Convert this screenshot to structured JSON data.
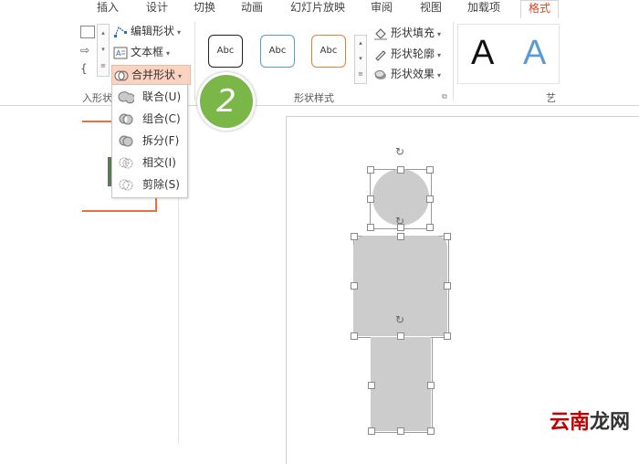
{
  "tabs": [
    "插入",
    "设计",
    "切换",
    "动画",
    "幻灯片放映",
    "审阅",
    "视图",
    "加载项",
    "格式"
  ],
  "ribbon": {
    "insert_shapes": {
      "edit_shape": "编辑形状",
      "text_box": "文本框",
      "merge_shapes": "合并形状",
      "group_label_partial": "入形状"
    },
    "shape_styles": {
      "samples": [
        "Abc",
        "Abc",
        "Abc"
      ],
      "sample_colors": [
        "#222222",
        "#5b9bd5",
        "#ed7d31"
      ],
      "fill": "形状填充",
      "outline": "形状轮廓",
      "effects": "形状效果",
      "group_label": "形状样式"
    },
    "wordart": {
      "samples": [
        "A",
        "A"
      ],
      "sample_colors": [
        "#111111",
        "#5b9bd5"
      ],
      "group_label_partial": "艺"
    }
  },
  "merge_menu": {
    "items": [
      {
        "label": "联合(U)",
        "icon": "union-icon"
      },
      {
        "label": "组合(C)",
        "icon": "combine-icon"
      },
      {
        "label": "拆分(F)",
        "icon": "fragment-icon"
      },
      {
        "label": "相交(I)",
        "icon": "intersect-icon"
      },
      {
        "label": "剪除(S)",
        "icon": "subtract-icon"
      }
    ]
  },
  "step_badge": "2",
  "watermark": {
    "text1": "云南",
    "text2": "龙网",
    "color1": "#c00000",
    "color2": "#333333"
  },
  "colors": {
    "accent": "#d24726",
    "badge": "#7ab648",
    "shape_fill": "#cccccc"
  }
}
